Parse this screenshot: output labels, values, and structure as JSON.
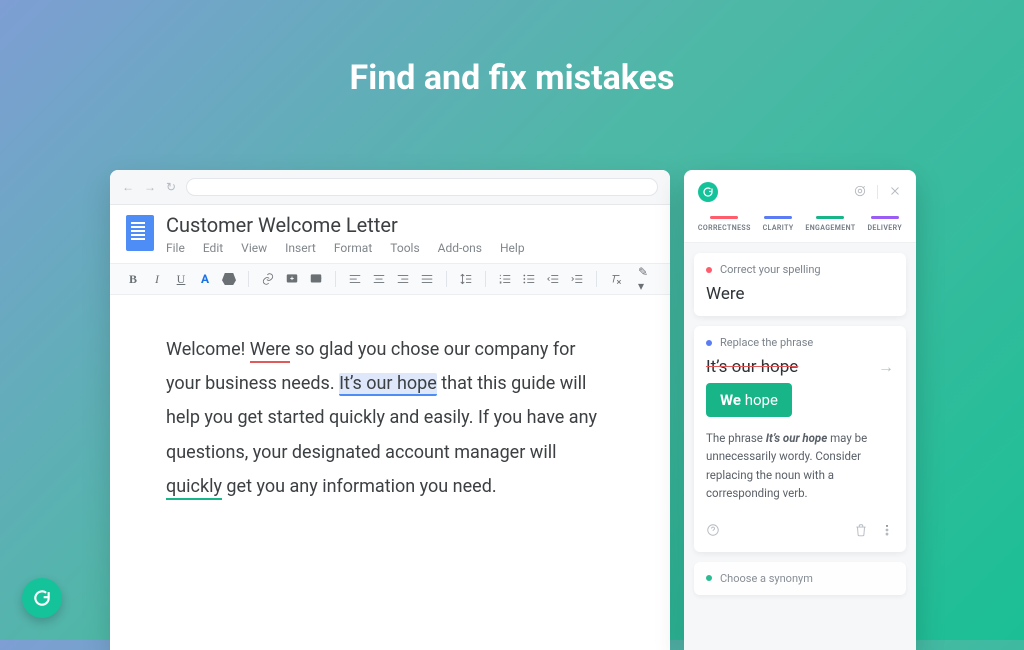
{
  "headline": "Find and fix mistakes",
  "doc": {
    "title": "Customer Welcome Letter",
    "menu": {
      "file": "File",
      "edit": "Edit",
      "view": "View",
      "insert": "Insert",
      "format": "Format",
      "tools": "Tools",
      "addons": "Add-ons",
      "help": "Help"
    },
    "body": {
      "t1": "Welcome! ",
      "err_red": "Were",
      "t2": " so glad you chose our company for your business needs. ",
      "err_blue": "It’s our hope",
      "t3": " that this guide will help you get started quickly and easily. If you have any questions, your designated account manager will ",
      "err_green": "quickly",
      "t4": " get you any information you need."
    }
  },
  "panel": {
    "categories": [
      {
        "label": "CORRECTNESS",
        "color": "#ff5c6c"
      },
      {
        "label": "CLARITY",
        "color": "#5b7cf4"
      },
      {
        "label": "ENGAGEMENT",
        "color": "#18b589"
      },
      {
        "label": "DELIVERY",
        "color": "#9a5cf4"
      }
    ],
    "card1": {
      "dot_color": "#ff5c6c",
      "title": "Correct your spelling",
      "value": "Were"
    },
    "card2": {
      "dot_color": "#5b7cf4",
      "title": "Replace the phrase",
      "strike": "It’s our hope",
      "chip_bold": "We",
      "chip_rest": " hope",
      "explain_pre": "The phrase ",
      "explain_bold": "It’s our hope",
      "explain_post": " may be unnecessarily wordy. Consider replacing the noun with a corresponding verb."
    },
    "card3": {
      "dot_color": "#18b589",
      "title": "Choose a synonym"
    }
  }
}
